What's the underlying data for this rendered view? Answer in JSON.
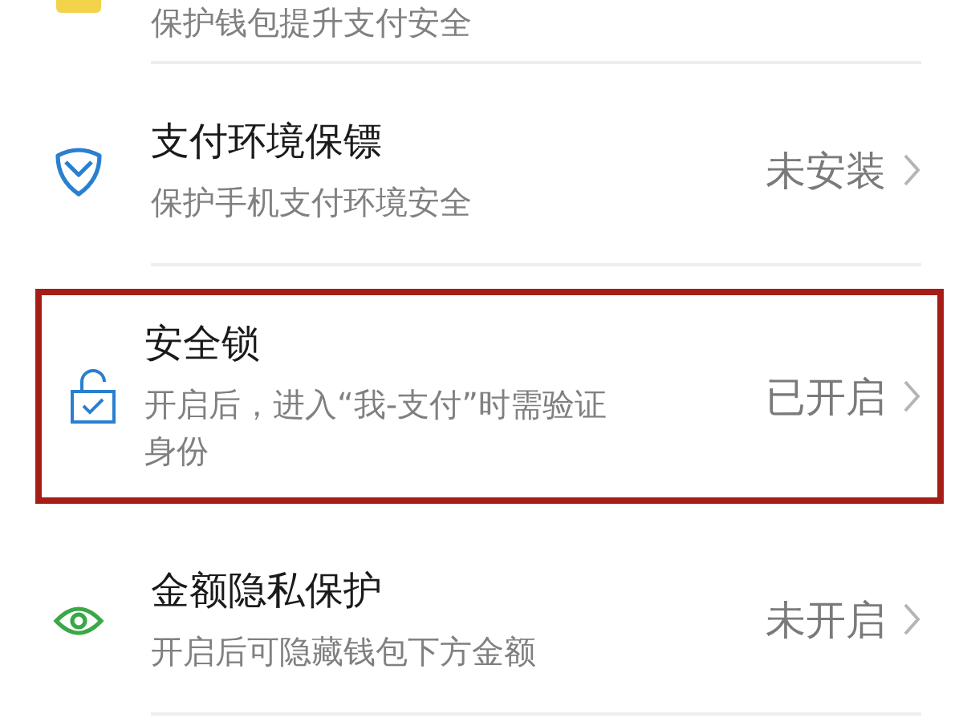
{
  "settings": [
    {
      "kind": "wallet",
      "subtitle": "保护钱包提升支付安全",
      "highlighted": false
    },
    {
      "kind": "shield",
      "title": "支付环境保镖",
      "subtitle": "保护手机支付环境安全",
      "status": "未安装",
      "highlighted": false
    },
    {
      "kind": "lock",
      "title": "安全锁",
      "subtitle": "开启后，进入“我-支付”时需验证身份",
      "status": "已开启",
      "highlighted": true
    },
    {
      "kind": "eye",
      "title": "金额隐私保护",
      "subtitle": "开启后可隐藏钱包下方金额",
      "status": "未开启",
      "highlighted": false
    }
  ]
}
